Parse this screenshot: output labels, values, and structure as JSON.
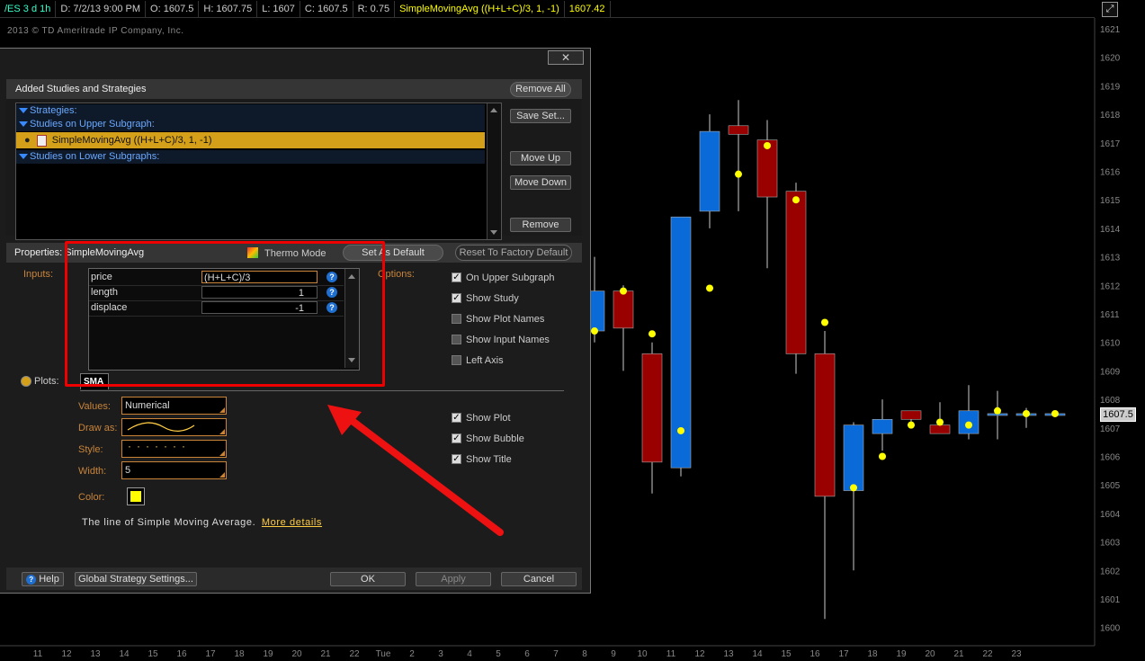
{
  "header": {
    "symbol": "/ES 3 d 1h",
    "date": "D: 7/2/13 9:00 PM",
    "open": "O: 1607.5",
    "high": "H: 1607.75",
    "low": "L: 1607",
    "close": "C: 1607.5",
    "range": "R: 0.75",
    "study": "SimpleMovingAvg ((H+L+C)/3, 1, -1)",
    "study_value": "1607.42"
  },
  "copyright": "2013 © TD Ameritrade IP Company, Inc.",
  "current_price": "1607.5",
  "price_axis": [
    "1621",
    "1620",
    "1619",
    "1618",
    "1617",
    "1616",
    "1615",
    "1614",
    "1613",
    "1612",
    "1611",
    "1610",
    "1609",
    "1608",
    "1607",
    "1606",
    "1605",
    "1604",
    "1603",
    "1602",
    "1601",
    "1600"
  ],
  "time_axis": [
    "11",
    "12",
    "13",
    "14",
    "15",
    "16",
    "17",
    "18",
    "19",
    "20",
    "21",
    "22",
    "Tue",
    "2",
    "3",
    "4",
    "5",
    "6",
    "7",
    "8",
    "9",
    "10",
    "11",
    "12",
    "13",
    "14",
    "15",
    "16",
    "17",
    "18",
    "19",
    "20",
    "21",
    "22",
    "23"
  ],
  "colors": {
    "up": "#0a6ad8",
    "down": "#990000",
    "sma": "#ffff00",
    "accent": "#c9843a",
    "highlight": "#ee0000"
  },
  "dialog": {
    "close_icon": "close-icon",
    "added_title": "Added Studies and Strategies",
    "remove_all": "Remove All",
    "save_set": "Save Set...",
    "move_up": "Move Up",
    "move_down": "Move Down",
    "remove": "Remove",
    "tree": {
      "strategies": "Strategies:",
      "upper": "Studies on Upper Subgraph:",
      "selected_study": "SimpleMovingAvg ((H+L+C)/3, 1, -1)",
      "lower": "Studies on Lower Subgraphs:"
    },
    "properties_label": "Properties: SimpleMovingAvg",
    "thermo_mode": "Thermo Mode",
    "set_default": "Set As Default",
    "reset_default": "Reset To Factory Default",
    "inputs_label": "Inputs:",
    "options_label": "Options:",
    "inputs": [
      {
        "name": "price",
        "value": "(H+L+C)/3"
      },
      {
        "name": "length",
        "value": "1"
      },
      {
        "name": "displace",
        "value": "-1"
      }
    ],
    "options": [
      {
        "label": "On Upper Subgraph",
        "checked": true
      },
      {
        "label": "Show Study",
        "checked": true
      },
      {
        "label": "Show Plot Names",
        "checked": false
      },
      {
        "label": "Show Input Names",
        "checked": false
      },
      {
        "label": "Left Axis",
        "checked": false
      }
    ],
    "plots_label": "Plots:",
    "plot_tab": "SMA",
    "plot_fields": {
      "values_label": "Values:",
      "values": "Numerical",
      "draw_label": "Draw as:",
      "style_label": "Style:",
      "width_label": "Width:",
      "width": "5",
      "color_label": "Color:",
      "color": "#ffff00"
    },
    "plot_options": [
      {
        "label": "Show Plot",
        "checked": true
      },
      {
        "label": "Show Bubble",
        "checked": true
      },
      {
        "label": "Show Title",
        "checked": true
      }
    ],
    "description": "The line of Simple Moving Average.",
    "more_details": "More details",
    "help": "Help",
    "global_settings": "Global Strategy Settings...",
    "ok": "OK",
    "apply": "Apply",
    "cancel": "Cancel"
  },
  "candles": [
    {
      "o": 1610.4,
      "h": 1613,
      "l": 1610,
      "c": 1611.8
    },
    {
      "o": 1611.8,
      "h": 1612,
      "l": 1609,
      "c": 1610.5
    },
    {
      "o": 1609.6,
      "h": 1610,
      "l": 1604.7,
      "c": 1605.8
    },
    {
      "o": 1605.6,
      "h": 1610.8,
      "l": 1605.3,
      "c": 1614.4
    },
    {
      "o": 1614.6,
      "h": 1618,
      "l": 1614,
      "c": 1617.4
    },
    {
      "o": 1617.6,
      "h": 1618.5,
      "l": 1614.6,
      "c": 1617.3
    },
    {
      "o": 1617.1,
      "h": 1617.8,
      "l": 1612.6,
      "c": 1615.1
    },
    {
      "o": 1615.3,
      "h": 1615.6,
      "l": 1608.9,
      "c": 1609.6
    },
    {
      "o": 1609.6,
      "h": 1610.4,
      "l": 1600.3,
      "c": 1604.6
    },
    {
      "o": 1604.8,
      "h": 1607.2,
      "l": 1602,
      "c": 1607.1
    },
    {
      "o": 1606.8,
      "h": 1608,
      "l": 1606.2,
      "c": 1607.3
    },
    {
      "o": 1607.6,
      "h": 1607.6,
      "l": 1607.1,
      "c": 1607.3
    },
    {
      "o": 1607.1,
      "h": 1607.9,
      "l": 1606.8,
      "c": 1606.8
    },
    {
      "o": 1606.8,
      "h": 1608.5,
      "l": 1606.6,
      "c": 1607.6
    },
    {
      "o": 1607.5,
      "h": 1608.3,
      "l": 1606.6,
      "c": 1607.5
    },
    {
      "o": 1607.5,
      "h": 1607.7,
      "l": 1607,
      "c": 1607.5
    },
    {
      "o": 1607.5,
      "h": 1607.5,
      "l": 1607.5,
      "c": 1607.5
    }
  ],
  "sma_points": [
    1610.4,
    1611.8,
    1610.3,
    1606.9,
    1611.9,
    1615.9,
    1616.9,
    1615,
    1610.7,
    1604.9,
    1606,
    1607.1,
    1607.2,
    1607.1,
    1607.6,
    1607.5,
    1607.5
  ]
}
